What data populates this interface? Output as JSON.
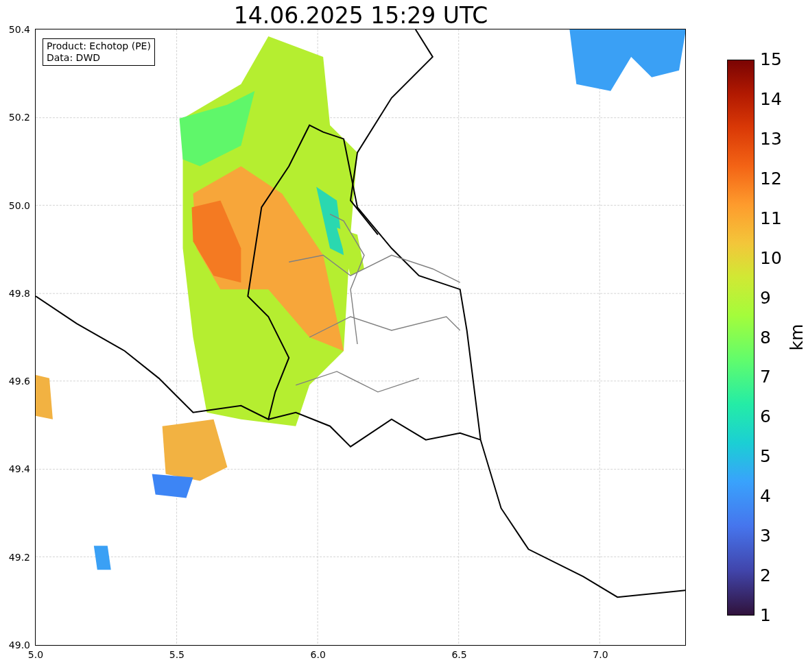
{
  "title": "14.06.2025 15:29 UTC",
  "info_box": [
    "Product: Echotop (PE)",
    "Data: DWD"
  ],
  "y_ticks": [
    "50.4",
    "50.2",
    "50.0",
    "49.8",
    "49.6",
    "49.4",
    "49.2",
    "49.0"
  ],
  "x_ticks": [
    "5.0",
    "5.5",
    "6.0",
    "6.5",
    "7.0"
  ],
  "colorbar": {
    "label": "km",
    "ticks": [
      "15",
      "14",
      "13",
      "12",
      "11",
      "10",
      "9",
      "8",
      "7",
      "6",
      "5",
      "4",
      "3",
      "2",
      "1"
    ]
  }
}
